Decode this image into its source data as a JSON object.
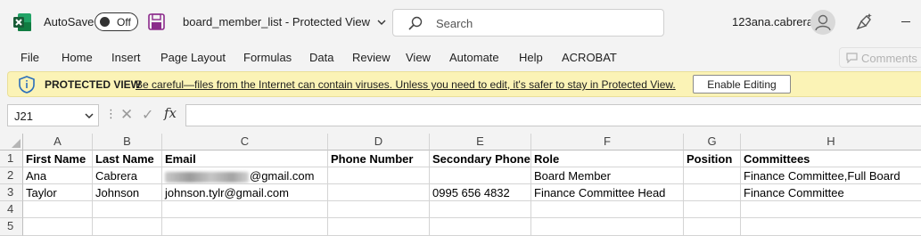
{
  "titlebar": {
    "autosave_label": "AutoSave",
    "autosave_state": "Off",
    "doc_title": "board_member_list  -  Protected View",
    "search_placeholder": "Search",
    "username": "123ana.cabrera",
    "brand_color": "#107c41"
  },
  "menu": [
    "File",
    "Home",
    "Insert",
    "Page Layout",
    "Formulas",
    "Data",
    "Review",
    "View",
    "Automate",
    "Help",
    "ACROBAT"
  ],
  "comments_label": "Comments",
  "protected_view": {
    "title": "PROTECTED VIEW",
    "message": "Be careful—files from the Internet can contain viruses. Unless you need to edit, it's safer to stay in Protected View.",
    "button": "Enable Editing",
    "bar_color": "#fbf3b6"
  },
  "formula_bar": {
    "name_box": "J21",
    "formula": ""
  },
  "sheet": {
    "columns": [
      "A",
      "B",
      "C",
      "D",
      "E",
      "F",
      "G",
      "H"
    ],
    "rows": [
      "1",
      "2",
      "3",
      "4",
      "5"
    ],
    "cells": [
      [
        "First Name",
        "Last Name",
        "Email",
        "Phone Number",
        "Secondary Phone",
        "Role",
        "Position",
        "Committees"
      ],
      [
        "Ana",
        "Cabrera",
        "@gmail.com",
        "",
        "",
        "Board Member",
        "",
        "Finance Committee,Full Board"
      ],
      [
        "Taylor",
        "Johnson",
        "johnson.tylr@gmail.com",
        "",
        "0995 656 4832",
        "Finance Committee Head",
        "",
        "Finance Committee"
      ],
      [
        "",
        "",
        "",
        "",
        "",
        "",
        "",
        ""
      ],
      [
        "",
        "",
        "",
        "",
        "",
        "",
        "",
        ""
      ]
    ]
  }
}
